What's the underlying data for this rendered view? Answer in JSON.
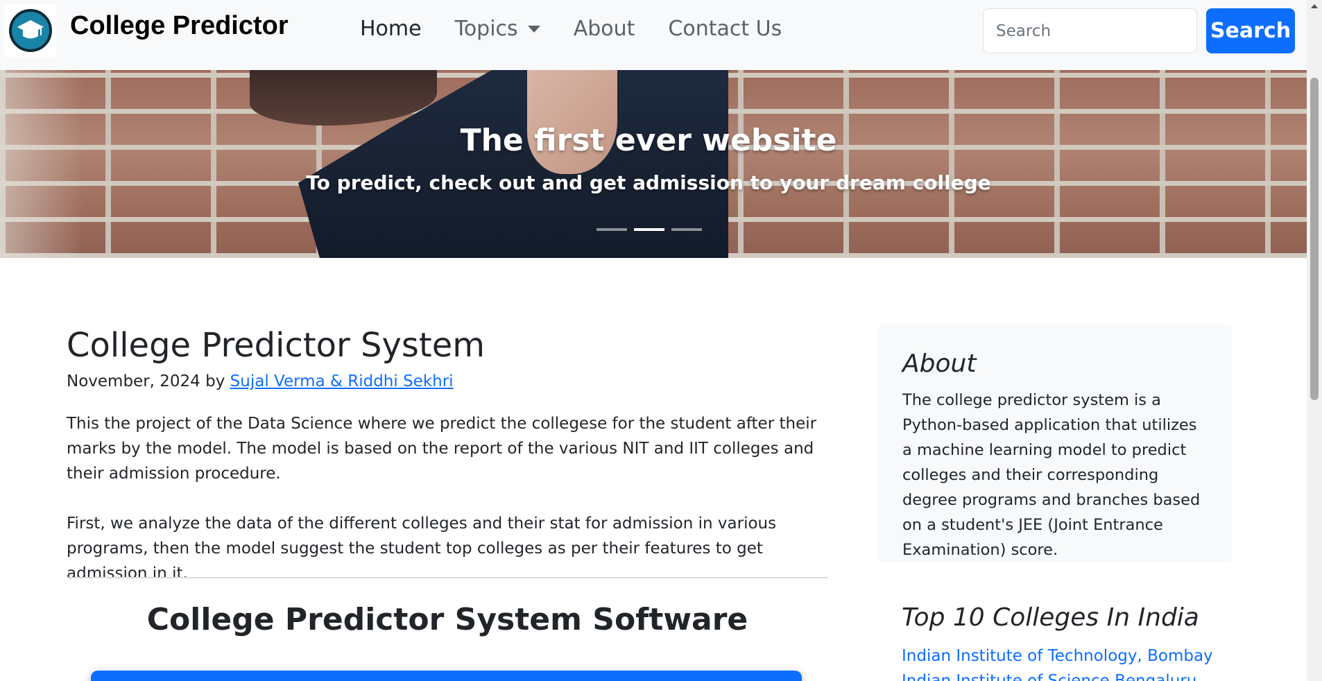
{
  "navbar": {
    "brand": "College Predictor",
    "logo_icon": "graduation-cap-icon",
    "links": [
      {
        "label": "Home",
        "active": true
      },
      {
        "label": "Topics",
        "dropdown": true
      },
      {
        "label": "About"
      },
      {
        "label": "Contact Us"
      }
    ],
    "search_placeholder": "Search",
    "search_button": "Search"
  },
  "hero": {
    "title": "The first ever website",
    "subtitle": "To predict, check out and get admission to your dream college",
    "active_slide": 2,
    "slide_count": 3
  },
  "post": {
    "title": "College Predictor System",
    "date": "November, 2024",
    "by": "by",
    "authors": "Sujal Verma & Riddhi Sekhri",
    "paragraphs": [
      "This the project of the Data Science where we predict the collegese for the student after their marks by the model. The model is based on the report of the various NIT and IIT colleges and their admission procedure.",
      "First, we analyze the data of the different colleges and their stat for admission in various programs, then the model suggest the student top colleges as per their features to get admission in it."
    ],
    "software_heading": "College Predictor System Software"
  },
  "sidebar": {
    "about_title": "About",
    "about_text": "The college predictor system is a Python-based application that utilizes a machine learning model to predict colleges and their corresponding degree programs and branches based on a student's JEE (Joint Entrance Examination) score.",
    "top10_title": "Top 10 Colleges In India",
    "top10": [
      "Indian Institute of Technology, Bombay",
      "Indian Institute of Science Bengaluru"
    ]
  },
  "colors": {
    "primary": "#0d6efd",
    "navbar_bg": "#f8f9fa",
    "card_bg": "#f8f9fa",
    "text": "#212529"
  }
}
